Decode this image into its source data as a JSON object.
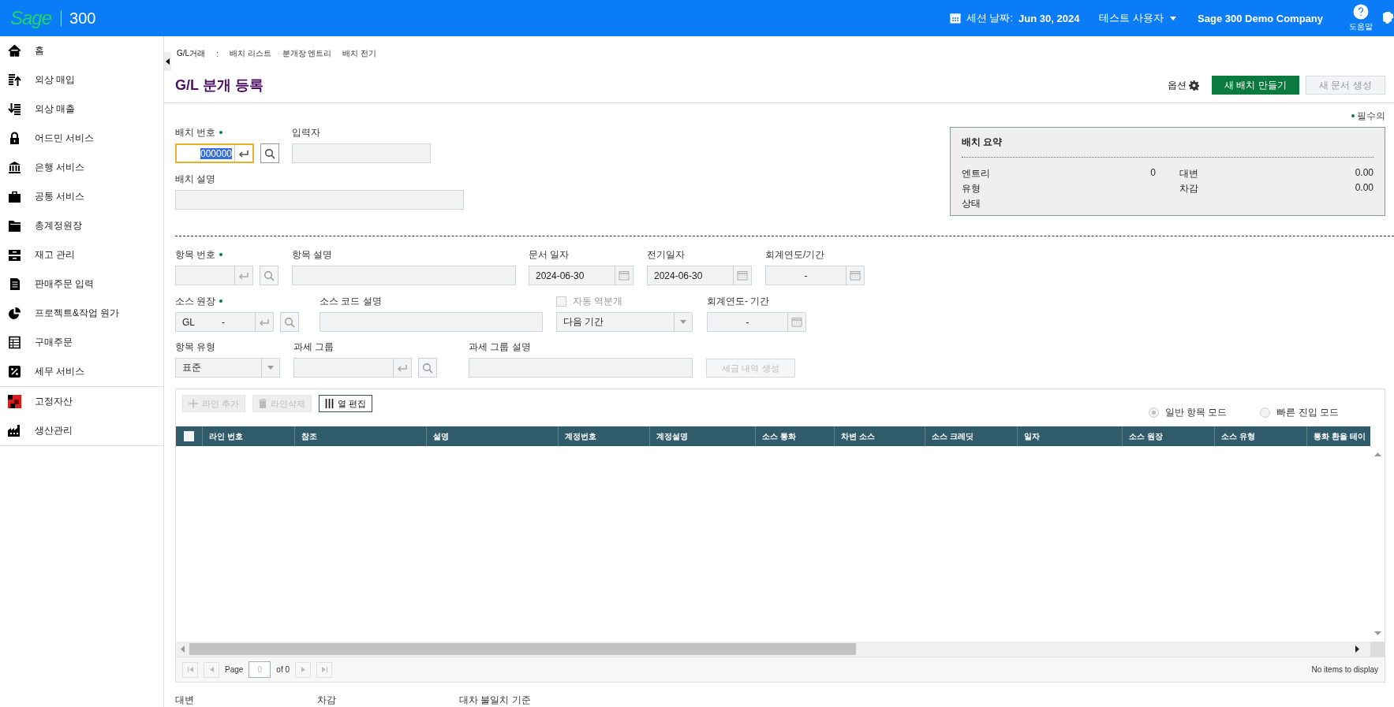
{
  "header": {
    "logo": "Sage",
    "product": "300",
    "session_label": "세션 날짜:",
    "session_date": "Jun 30, 2024",
    "user": "테스트 사용자",
    "company": "Sage 300 Demo Company",
    "help_label": "도움말"
  },
  "sidebar": {
    "sections": [
      {
        "items": [
          {
            "label": "홈"
          },
          {
            "label": "외상 매입"
          },
          {
            "label": "외상 매출"
          },
          {
            "label": "어드민 서비스"
          },
          {
            "label": "은행 서비스"
          },
          {
            "label": "공통 서비스"
          },
          {
            "label": "총계정원장"
          },
          {
            "label": "재고 관리"
          },
          {
            "label": "판매주문 입력"
          },
          {
            "label": "프로젝트&작업 원가"
          },
          {
            "label": "구매주문"
          },
          {
            "label": "세무 서비스"
          }
        ]
      },
      {
        "items": [
          {
            "label": "고정자산"
          },
          {
            "label": "생산관리"
          }
        ]
      }
    ]
  },
  "breadcrumb": [
    {
      "kind": "title",
      "label": "G/L거래"
    },
    {
      "kind": "separator",
      "label": ":"
    },
    {
      "kind": "link",
      "label": "배치 리스트"
    },
    {
      "kind": "link",
      "label": "분개장 엔트리"
    },
    {
      "kind": "link",
      "label": "배치 전기"
    }
  ],
  "page_title": "G/L 분개 등록",
  "actions": {
    "options_label": "옵션",
    "buttons": [
      {
        "label": "새 배치 만들기",
        "disabled": false
      },
      {
        "label": "새 문서 생성",
        "disabled": true
      }
    ]
  },
  "required_legend": "필수의",
  "batch": {
    "rows": [
      [
        {
          "kind": "numeric_lookup",
          "label": "배치 번호",
          "required": true,
          "value": "000000",
          "focused": true,
          "disabled": false
        },
        {
          "kind": "text",
          "label": "입력자",
          "required": false,
          "focused": false,
          "disabled": true
        }
      ],
      [
        {
          "kind": "text",
          "label": "배치 설명",
          "required": false,
          "focused": false,
          "disabled": true
        }
      ]
    ]
  },
  "summary": {
    "title": "배치 요약",
    "columns": [
      [
        {
          "label": "엔트리",
          "value": "0"
        },
        {
          "label": "유형"
        },
        {
          "label": "상태"
        }
      ],
      [
        {
          "label": "대변",
          "value": "0.00"
        },
        {
          "label": "차감",
          "value": "0.00"
        }
      ]
    ]
  },
  "entry": {
    "rows": [
      [
        {
          "kind": "lookup",
          "label": "항목 번호",
          "required": true,
          "focused": false,
          "disabled": true
        },
        {
          "kind": "text",
          "label": "항목 설명",
          "required": false,
          "focused": false,
          "disabled": true
        },
        {
          "kind": "date",
          "label": "문서 일자",
          "required": false,
          "value": "2024-06-30",
          "focused": false,
          "disabled": true
        },
        {
          "kind": "date",
          "label": "전기일자",
          "required": false,
          "value": "2024-06-30",
          "focused": false,
          "disabled": true
        },
        {
          "kind": "period",
          "label": "회계연도/기간",
          "required": false,
          "value": "-",
          "focused": false,
          "disabled": true
        }
      ],
      [
        {
          "kind": "lookup",
          "label": "소스 원장",
          "required": true,
          "values": [
            "GL",
            "-"
          ],
          "focused": false,
          "disabled": true
        },
        {
          "kind": "text",
          "label": "소스 코드 설명",
          "required": false,
          "focused": false,
          "disabled": true
        },
        {
          "kind": "select",
          "label": "자동 역분개",
          "checkbox": {
            "checked": false
          },
          "required": false,
          "value": "다음 기간",
          "focused": false,
          "disabled": true
        },
        {
          "kind": "period",
          "label": "회계연도- 기간",
          "required": false,
          "value": "-",
          "focused": false,
          "disabled": true
        }
      ],
      [
        {
          "kind": "select",
          "label": "항목 유형",
          "required": false,
          "value": "표준",
          "focused": false,
          "disabled": true
        },
        {
          "kind": "lookup",
          "label": "과세 그룹",
          "required": false,
          "focused": false,
          "disabled": true
        },
        {
          "kind": "text",
          "label": "과세 그룹 설명",
          "required": false,
          "focused": false,
          "disabled": true
        },
        {
          "kind": "action",
          "label": "세금 내역 생성",
          "disabled": true
        }
      ]
    ]
  },
  "grid": {
    "tools": [
      {
        "label": "라인 추가",
        "disabled": true
      },
      {
        "label": "라인삭제",
        "disabled": true
      },
      {
        "label": "열 편집",
        "disabled": false
      }
    ],
    "modes": [
      {
        "label": "일반 항목 모드",
        "selected": true
      },
      {
        "label": "빠른 진입 모드",
        "selected": false
      }
    ],
    "select_all": {
      "checked": false
    },
    "columns": [
      "라인 번호",
      "참조",
      "설명",
      "계정번호",
      "계정설명",
      "소스 통화",
      "차변 소스",
      "소스 크레딧",
      "일자",
      "소스 원장",
      "소스 유형",
      "통화 환율 테이"
    ],
    "pager": {
      "page_label": "Page",
      "page": "0",
      "of_label": "of 0",
      "status": "No items to display"
    }
  },
  "totals": [
    {
      "label": "대변"
    },
    {
      "label": "차감"
    },
    {
      "label": "대차 불일치 기준"
    }
  ]
}
